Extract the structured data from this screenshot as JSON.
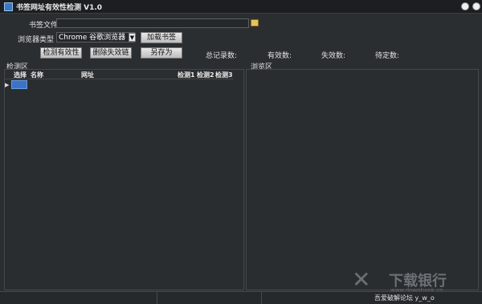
{
  "window": {
    "title": "书签网址有效性检测 V1.0"
  },
  "form": {
    "bookmark_file_label": "书签文件",
    "bookmark_file_value": "",
    "browser_type_label": "浏览器类型",
    "browser_selected": "Chrome 谷歌浏览器",
    "load_button": "加载书签"
  },
  "actions": {
    "check_button": "检测有效性",
    "delete_button": "删除失效链",
    "save_as_button": "另存为"
  },
  "stats": {
    "total_label": "总记录数:",
    "valid_label": "有效数:",
    "invalid_label": "失效数:",
    "pending_label": "待定数:"
  },
  "detect_area": {
    "title": "检测区",
    "columns": [
      "选择",
      "名称",
      "网址",
      "检测1",
      "检测2",
      "检测3"
    ]
  },
  "browse_area": {
    "title": "浏览区"
  },
  "status": {
    "text": "吾爱破解论坛 y_w_o"
  },
  "watermark": {
    "brand": "下载银行",
    "url": "www.downbank.cn"
  }
}
